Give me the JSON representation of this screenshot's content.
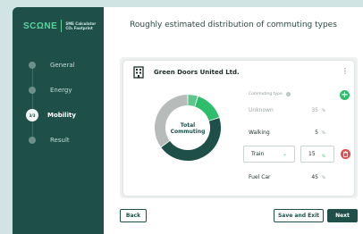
{
  "brand": {
    "logo_text": "SCΩNE",
    "subtitle_line1": "SME Calculator",
    "subtitle_line2": "CO₂ Footprint"
  },
  "sidebar": {
    "steps": [
      {
        "label": "General",
        "badge": ""
      },
      {
        "label": "Energy",
        "badge": ""
      },
      {
        "label": "Mobility",
        "badge": "3/3",
        "active": true
      },
      {
        "label": "Result",
        "badge": ""
      }
    ]
  },
  "main": {
    "title": "Roughly estimated distribution of commuting types"
  },
  "card": {
    "company_name": "Green Doors United Ltd.",
    "donut_label_line1": "Total",
    "donut_label_line2": "Commuting",
    "commuting_header": "Commuting type",
    "rows": [
      {
        "type": "Unknown",
        "percent": "35",
        "unit": "%"
      },
      {
        "type": "Walking",
        "percent": "5",
        "unit": "%"
      },
      {
        "type": "Train",
        "percent": "15",
        "unit": "%"
      },
      {
        "type": "Fuel Car",
        "percent": "45",
        "unit": "%"
      }
    ],
    "chevron": "⌄"
  },
  "buttons": {
    "back": "Back",
    "save_exit": "Save and Exit",
    "next": "Next"
  },
  "colors": {
    "dark_green": "#1e4f49",
    "light_green": "#2ebd6b",
    "mid_green": "#5cc68c",
    "grey": "#b7bcbb",
    "red": "#e84a4f"
  }
}
